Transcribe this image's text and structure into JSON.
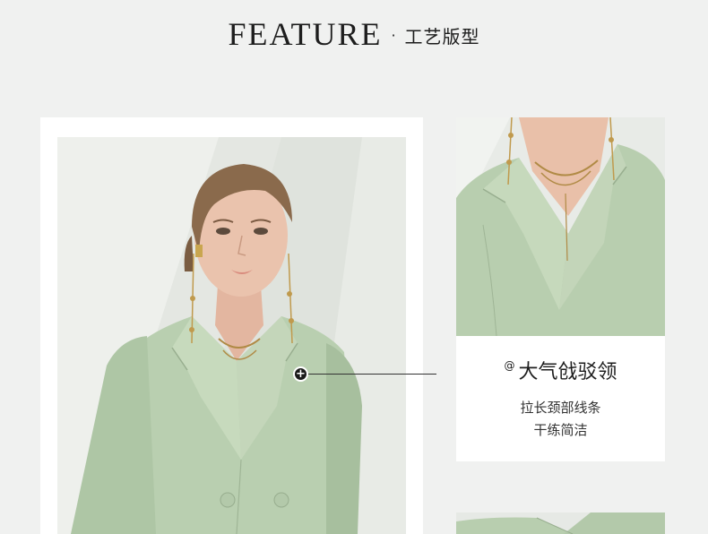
{
  "header": {
    "title_en": "FEATURE",
    "separator": "·",
    "title_cn": "工艺版型"
  },
  "feature": {
    "at_symbol": "@",
    "title": "大气戗驳领",
    "desc_line1": "拉长颈部线条",
    "desc_line2": "干练简洁"
  },
  "callout": {
    "marker_glyph": "+"
  },
  "colors": {
    "page_bg": "#f0f1f0",
    "card_bg": "#ffffff",
    "jacket_green": "#b9cfb0",
    "text_dark": "#1d1d1d"
  }
}
